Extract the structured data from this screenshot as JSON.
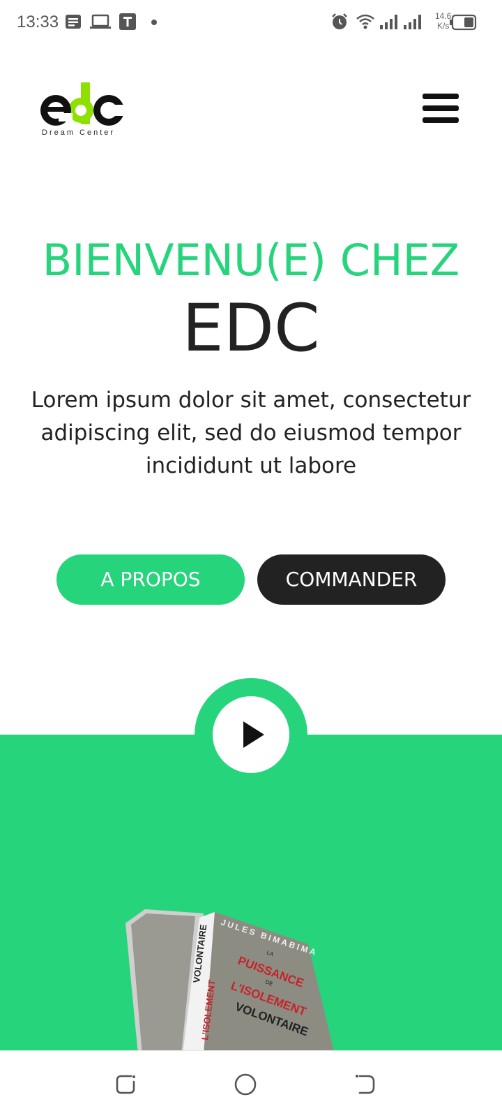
{
  "status_bar": {
    "time": "13:33",
    "left_icons": [
      "notes-icon",
      "laptop-icon",
      "t-app-icon",
      "dot-icon"
    ],
    "right_icons": [
      "alarm-icon",
      "wifi-icon",
      "signal-icon",
      "signal-icon",
      "battery-icon"
    ],
    "net_speed_value": "14.6",
    "net_speed_unit": "K/s"
  },
  "header": {
    "logo_text": "edc",
    "logo_tagline": "Dream Center",
    "menu_icon": "hamburger-menu-icon"
  },
  "hero": {
    "title": "BIENVENU(E) CHEZ",
    "brand": "EDC",
    "text": "Lorem ipsum dolor sit amet, consectetur adipiscing elit, sed do eiusmod tempor incididunt ut labore"
  },
  "buttons": {
    "about_label": "A PROPOS",
    "order_label": "COMMANDER"
  },
  "video": {
    "play_icon": "play-icon"
  },
  "book": {
    "author": "JULES BIMABIMA",
    "title_line1": "LA",
    "title_line2": "PUISSANCE",
    "title_line3": "DE",
    "title_line4": "L'ISOLEMENT",
    "title_line5": "VOLONTAIRE",
    "spine_text_a": "L'ISOLEMENT",
    "spine_text_b": "VOLONTAIRE"
  },
  "nav_bar": {
    "icons": [
      "recent-apps-icon",
      "home-icon",
      "back-icon"
    ]
  },
  "colors": {
    "accent": "#26d47c",
    "dark": "#222222",
    "logo_green": "#8ee000"
  }
}
